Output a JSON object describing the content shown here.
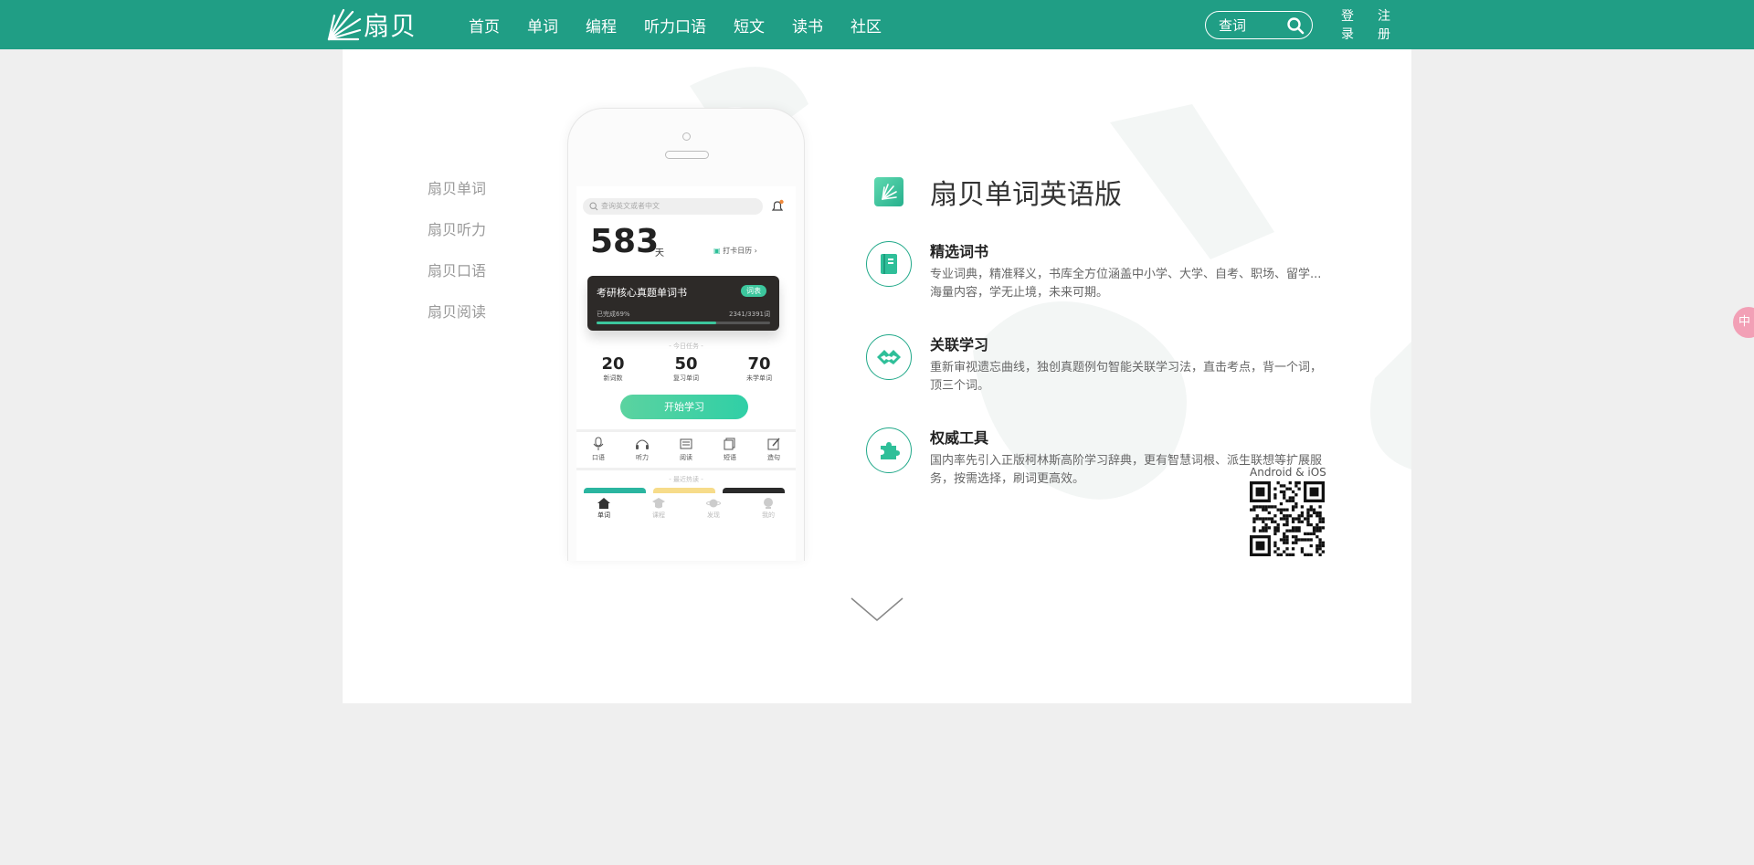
{
  "header": {
    "logo_text": "扇贝",
    "nav": [
      "首页",
      "单词",
      "编程",
      "听力口语",
      "短文",
      "读书",
      "社区"
    ],
    "search_placeholder": "查词",
    "login": "登录",
    "register": "注册"
  },
  "side_nav": [
    "扇贝单词",
    "扇贝听力",
    "扇贝口语",
    "扇贝阅读"
  ],
  "phone": {
    "search_placeholder": "查询英文或者中文",
    "days": "583",
    "days_unit": "天",
    "calendar": "打卡日历",
    "book_title": "考研核心真题单词书",
    "book_badge": "词表",
    "book_progress_text": "已完成69%",
    "book_count": "2341/3391词",
    "book_progress": 0.69,
    "plan_label": "- 今日任务 -",
    "stats": [
      {
        "num": "20",
        "label": "新词数"
      },
      {
        "num": "50",
        "label": "复习单词"
      },
      {
        "num": "70",
        "label": "未学单词"
      }
    ],
    "start_button": "开始学习",
    "tools": [
      "口语",
      "听力",
      "阅读",
      "短语",
      "造句"
    ],
    "rec_label": "- 最近热读 -",
    "tabs": [
      "单词",
      "课程",
      "发现",
      "我的"
    ]
  },
  "product": {
    "title": "扇贝单词英语版",
    "features": [
      {
        "title": "精选词书",
        "desc": "专业词典，精准释义，书库全方位涵盖中小学、大学、自考、职场、留学...海量内容，学无止境，未来可期。"
      },
      {
        "title": "关联学习",
        "desc": "重新审视遗忘曲线，独创真题例句智能关联学习法，直击考点，背一个词，顶三个词。"
      },
      {
        "title": "权威工具",
        "desc": "国内率先引入正版柯林斯高阶学习辞典，更有智慧词根、派生联想等扩展服务，按需选择，刷词更高效。"
      }
    ],
    "qr_label": "Android & iOS"
  },
  "float_button": "中",
  "colors": {
    "brand": "#209e85",
    "accent": "#2fbf99"
  }
}
